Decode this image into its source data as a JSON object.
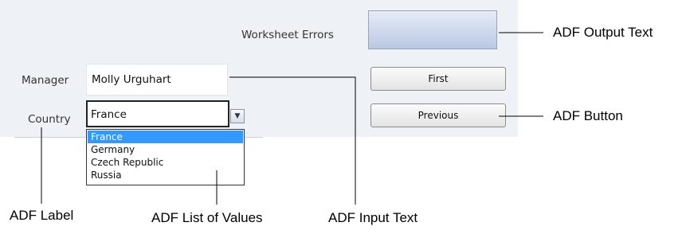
{
  "form": {
    "worksheet_errors_label": "Worksheet Errors",
    "manager_label": "Manager",
    "manager_value": "Molly Urguhart",
    "country_label": "Country",
    "country_value": "France",
    "country_options": [
      "France",
      "Germany",
      "Czech Republic",
      "Russia"
    ],
    "first_button": "First",
    "previous_button": "Previous"
  },
  "callouts": {
    "output_text": "ADF Output Text",
    "button": "ADF Button",
    "label": "ADF Label",
    "list_of_values": "ADF List of Values",
    "input_text": "ADF Input Text"
  },
  "colors": {
    "panel_bg": "#eef1f6",
    "selected_option": "#3399ff",
    "output_box_gradient": [
      "#e6ecf8",
      "#b9c8e2"
    ]
  },
  "icons": {
    "dropdown": "chevron-down-icon"
  }
}
